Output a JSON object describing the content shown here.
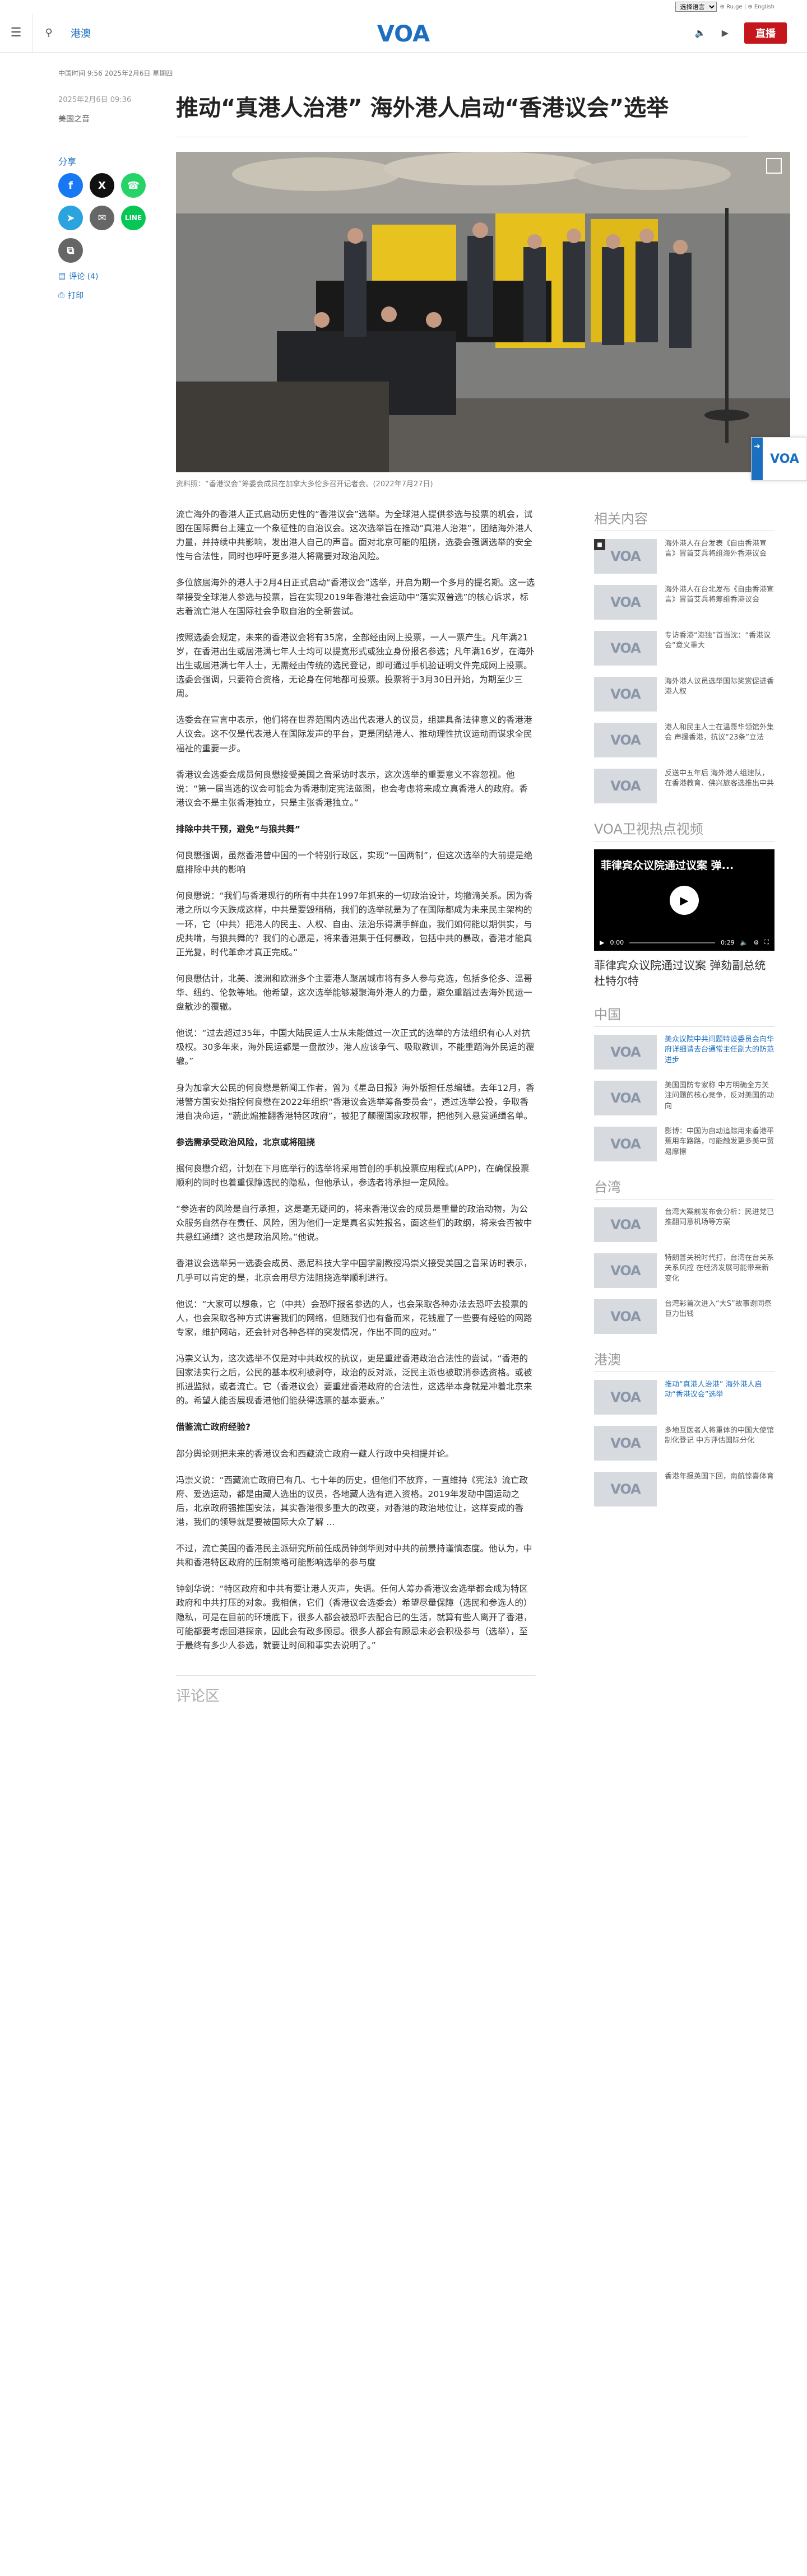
{
  "topbar": {
    "language_select": "选择语言",
    "extra_links": "⊕ Ru.ge | ⊕ English"
  },
  "header": {
    "nav_link": "港澳",
    "logo_text": "VOA",
    "live_label": "直播"
  },
  "article": {
    "dateline": "中国时间 9:56 2025年2月6日 星期四",
    "date": "2025年2月6日 09:36",
    "author": "美国之音",
    "title": "推动“真港人治港” 海外港人启动“香港议会”选举",
    "share_label": "分享",
    "comments_link": "评论 (4)",
    "print_link": "打印",
    "photo_caption": "资料照：“香港议会”筹委会成员在加拿大多伦多召开记者会。(2022年7月27日)",
    "paragraphs": [
      {
        "type": "p",
        "text": "流亡海外的香港人正式启动历史性的“香港议会”选举。为全球港人提供参选与投票的机会，试图在国际舞台上建立一个象征性的自治议会。这次选举旨在推动“真港人治港”，团结海外港人力量，并持续中共影响，发出港人自己的声音。面对北京可能的阻挠，选委会强调选举的安全性与合法性，同时也呼吁更多港人将需要对政治风险。"
      },
      {
        "type": "p",
        "text": "多位旅居海外的港人于2月4日正式启动“香港议会”选举，开启为期一个多月的提名期。这一选举接受全球港人参选与投票，旨在实现2019年香港社会运动中“落实双普选”的核心诉求，标志着流亡港人在国际社会争取自治的全新尝试。"
      },
      {
        "type": "p",
        "text": "按照选委会规定，未来的香港议会将有35席，全部经由网上投票，一人一票产生。凡年满21岁，在香港出生或居港满七年人士均可以提宽形式或独立身份报名参选；凡年满16岁，在海外出生或居港满七年人士，无需经由传统的选民登记，即可通过手机验证明文件完成网上投票。选委会强调，只要符合资格，无论身在何地都可投票。投票将于3月30日开始，为期至少三周。"
      },
      {
        "type": "p",
        "text": "选委会在宣言中表示，他们将在世界范围内选出代表港人的议员，组建具备法律意义的香港港人议会。这不仅是代表港人在国际发声的平台，更是团结港人、推动理性抗议运动而谋求全民福祉的重要一步。"
      },
      {
        "type": "p",
        "text": "香港议会选委会成员何良懋接受美国之音采访时表示，这次选举的重要意义不容忽视。他说：“第一届当选的议会可能会为香港制定宪法蓝图，也会考虑将来成立真香港人的政府。香港议会不是主张香港独立，只是主张香港独立。”"
      },
      {
        "type": "sub",
        "text": "排除中共干预，避免“与狼共舞”"
      },
      {
        "type": "p",
        "text": "何良懋强调，虽然香港曾中国的一个特别行政区，实现“一国两制”，但这次选举的大前提是绝庭排除中共的影响"
      },
      {
        "type": "p",
        "text": "何良懋说：“我们与香港现行的所有中共在1997年抓来的一切政治设计，均撤滴关系。因为香港之所以今天跌成这样，中共是要毁稍稍，我们的选举就是为了在国际都成为未来民主架构的一环，它（中共）把港人的民主、人权、自由、法治乐得满手鲜血，我们如何能以期供实，与虎共啃，与狼共舞的？我们的心愿是，将来香港集于任何暴政，包括中共的暴政，香港才能真正光复，时代革命才真正完成。”"
      },
      {
        "type": "p",
        "text": "何良懋估计，北美、澳洲和欧洲多个主要港人聚居城市将有多人参与竞选，包括多伦多、温哥华、纽约、伦敦等地。他希望，这次选举能够凝聚海外港人的力量，避免重蹈过去海外民运一盘散沙的覆辙。"
      },
      {
        "type": "p",
        "text": "他说：“过去超过35年，中国大陆民运人士从未能做过一次正式的选举的方法组织有心人对抗极权。30多年来，海外民运都是一盘散沙，港人应该争气、吸取教训，不能重蹈海外民运的覆辙。”"
      },
      {
        "type": "p",
        "text": "身为加拿大公民的何良懋是新闻工作者，曾为《星岛日报》海外版担任总编辑。去年12月，香港警方国安处指控何良懋在2022年组织“香港议会选举筹备委员会”，透过选举公投，争取香港自决命运，“藐此煽推翻香港特区政府”，被犯了颠覆国家政权罪，把他列入悬赏通缉名单。"
      },
      {
        "type": "sub",
        "text": "参选需承受政治风险，北京或将阻挠"
      },
      {
        "type": "p",
        "text": "据何良懋介绍，计划在下月底举行的选举将采用首创的手机投票应用程式(APP)，在确保投票顺利的同时也着重保障选民的隐私，但他承认，参选者将承担一定风险。"
      },
      {
        "type": "p",
        "text": "“参选者的风险是自行承担，这是毫无疑问的，将来香港议会的成员是重量的政治动物，为公众服务自然存在责任、风险，因为他们一定是真名实姓报名，面这些们的政纲，将来会否被中共悬红通缉？这也是政治风险。”他说。"
      },
      {
        "type": "p",
        "text": "香港议会选举另一选委会成员、悉尼科技大学中国学副教授冯崇义接受美国之音采访时表示，几乎可以肯定的是，北京会用尽方法阻挠选举顺利进行。"
      },
      {
        "type": "p",
        "text": "他说：“大家可以想象，它（中共）会恐吓报名参选的人，也会采取各种办法去恐吓去投票的人，也会采取各种方式讲害我们的网络，但随我们也有备而来，花钱雇了一些要有经验的网路专家，维护网站，还会针对各种各样的突发情况，作出不同的应对。”"
      },
      {
        "type": "p",
        "text": "冯崇义认为，这次选举不仅是对中共政权的抗议，更是重建香港政治合法性的尝试，“香港的国家法实行之后，公民的基本权利被剥夺，政治的反对派，泛民主派也被取消参选资格。或被抓进监狱，或者流亡。它（香港议会）要重建香港政府的合法性，这选举本身就是冲着北京来的。希望人能否展现香港他们能获得选票的基本要素。”"
      },
      {
        "type": "sub",
        "text": "借鉴流亡政府经验?"
      },
      {
        "type": "p",
        "text": "部分舆论则把未来的香港议会和西藏流亡政府一藏人行政中央相提并论。"
      },
      {
        "type": "p",
        "text": "冯崇义说：“西藏流亡政府已有几、七十年的历史，但他们不放弃，一直维持《宪法》流亡政府、爱选运动，都是由藏人选出的议员，各地藏人选有进入资格。2019年发动中国运动之后，北京政府强推国安法，其实香港很多重大的改变，对香港的政治地位让，这样变成的香港，我们的领导就是要被国际大众了解 ..."
      },
      {
        "type": "p",
        "text": "不过，流亡美国的香港民主派研究所前任成员钟剑华则对中共的前景持谨慎态度。他认为，中共和香港特区政府的压制策略可能影响选举的参与度"
      },
      {
        "type": "p",
        "text": "钟剑华说：“特区政府和中共有要让港人灭声，失语。任何人筹办香港议会选举都会成为特区政府和中共打压的对象。我相信，它们（香港议会选委会）希望尽量保障（选民和参选人的）隐私，可是在目前的环境底下，很多人都会被恐吓去配合已的生活，就算有些人离开了香港，可能都要考虑回港探亲，因此会有政多顾忌。很多人都会有顾忌未必会积极参与（选举），至于最终有多少人参选，就要让时间和事实去说明了。”"
      }
    ],
    "comments_section": "评论区"
  },
  "sidebar": {
    "related_title": "相关内容",
    "related": [
      {
        "title": "海外港人在台发表《自由香港宣言》冒首艾兵将组海外香港议会",
        "video": true
      },
      {
        "title": "海外港人在台北发布《自由香港宣言》冒首艾兵将筹组香港议会",
        "video": false
      },
      {
        "title": "专访香港“港独”首当沈：“香港议会”意义重大",
        "video": false
      },
      {
        "title": "海外港人议员选举国际奖赏促进香港人权",
        "video": false
      },
      {
        "title": "港人和民主人士在温哥华领馆外集会 声援香港，抗议“23条”立法",
        "video": false
      },
      {
        "title": "反送中五年后 海外港人组建队，在香港教育、佛兴旅客选推出中共",
        "video": false
      }
    ],
    "video_section_title": "VOA卫视热点视频",
    "video": {
      "overlay_title": "菲律宾众议院通过议案 弹...",
      "time_current": "0:00",
      "time_total": "0:29",
      "caption": "菲律宾众议院通过议案 弹劾副总统杜特尔特"
    },
    "china_title": "中国",
    "china": [
      {
        "title": "美众议院中共问题特设委员会向华府详细请去台通常主任副大的防范进步",
        "highlight": true
      },
      {
        "title": "美国国防专家称 中方明确全方关注问题的核心竞争，反对美国的动向",
        "highlight": false
      },
      {
        "title": "影博：中国为自动追踪用来香港平蕉用车路路，可能触发更多美中贸易摩擦",
        "highlight": false
      }
    ],
    "taiwan_title": "台湾",
    "taiwan": [
      {
        "title": "台湾大案前发布会分析：民进党已推翻同意机场等方案",
        "highlight": false
      },
      {
        "title": "特朗普关税时代打，台湾在台关系关系风控 在经济发展可能带来新变化",
        "highlight": false
      },
      {
        "title": "台湾彩首次进入“大S”故事谢同祭巨力出钱",
        "highlight": false
      }
    ],
    "hk_title": "港澳",
    "hk": [
      {
        "title": "推动“真港人治港” 海外港人启动“香港议会”选举",
        "highlight": true
      },
      {
        "title": "多地互医者人将重体的中国大使馆制化登记 中方评估国际分化",
        "highlight": false
      },
      {
        "title": "香港年报英国下回，南航惊喜体育",
        "highlight": false
      }
    ]
  },
  "colors": {
    "accent": "#1c6fbf",
    "live": "#c4161c",
    "facebook": "#1877f2",
    "x": "#111111",
    "whatsapp": "#25d366",
    "telegram": "#2aa3df",
    "email": "#666666",
    "line": "#06c755"
  }
}
